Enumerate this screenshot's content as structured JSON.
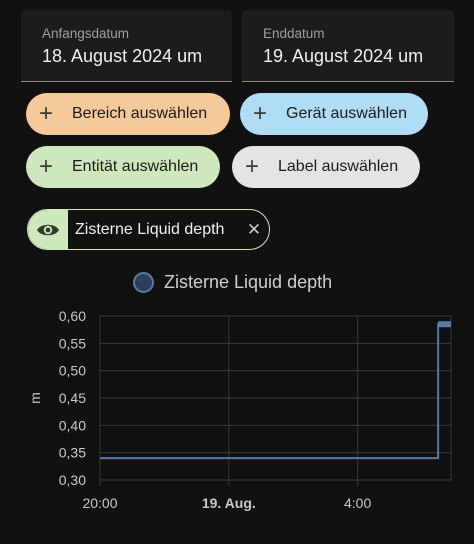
{
  "date_range": {
    "start": {
      "label": "Anfangsdatum",
      "value": "18. August 2024 um"
    },
    "end": {
      "label": "Enddatum",
      "value": "19. August 2024 um"
    }
  },
  "target_chips": [
    {
      "label": "Bereich auswählen",
      "color": "#f6c99a"
    },
    {
      "label": "Gerät auswählen",
      "color": "#b0dcf5"
    },
    {
      "label": "Entität auswählen",
      "color": "#cfe7bd"
    },
    {
      "label": "Label auswählen",
      "color": "#e4e4e4"
    }
  ],
  "selected_entity": {
    "name": "Zisterne Liquid depth",
    "icon": "eye-icon",
    "remove_icon": "close-icon"
  },
  "chart_data": {
    "type": "line",
    "title": "",
    "legend": [
      "Zisterne Liquid depth"
    ],
    "legend_placement": "top-center",
    "ylabel": "m",
    "xlabel": "",
    "ylim": [
      0.3,
      0.6
    ],
    "y_ticks": [
      "0,60",
      "0,55",
      "0,50",
      "0,45",
      "0,40",
      "0,35",
      "0,30"
    ],
    "y_tick_values": [
      0.6,
      0.55,
      0.5,
      0.45,
      0.4,
      0.35,
      0.3
    ],
    "x_ticks": [
      {
        "label": "20:00",
        "hour": 20,
        "bold": false
      },
      {
        "label": "19. Aug.",
        "hour": 24,
        "bold": true
      },
      {
        "label": "4:00",
        "hour": 28,
        "bold": false
      }
    ],
    "xlim_hours": [
      20,
      30.9
    ],
    "grid": true,
    "series": [
      {
        "name": "Zisterne Liquid depth",
        "color": "#5a79a6",
        "points": [
          {
            "hour": 20.0,
            "value": 0.34
          },
          {
            "hour": 30.5,
            "value": 0.34
          },
          {
            "hour": 30.5,
            "value": 0.585
          },
          {
            "hour": 30.9,
            "value": 0.585
          }
        ]
      }
    ]
  }
}
